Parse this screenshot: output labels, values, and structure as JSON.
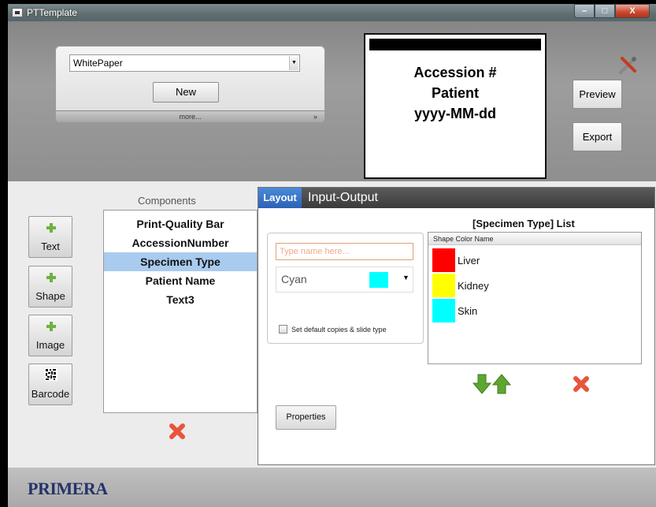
{
  "window": {
    "title": "PTTemplate",
    "controls": {
      "minimize": "–",
      "maximize": "□",
      "close": "X"
    }
  },
  "template": {
    "selected": "WhitePaper",
    "new_label": "New",
    "more_label": "more...",
    "more_chevron": "»"
  },
  "label_preview": {
    "lines": [
      "Accession #",
      "Patient",
      "yyyy-MM-dd"
    ]
  },
  "actions": {
    "preview_label": "Preview",
    "export_label": "Export",
    "tools_icon": "tools-icon"
  },
  "toolbox": {
    "items": [
      {
        "label": "Text",
        "icon": "plus-icon"
      },
      {
        "label": "Shape",
        "icon": "plus-icon"
      },
      {
        "label": "Image",
        "icon": "plus-icon"
      },
      {
        "label": "Barcode",
        "icon": "barcode-icon"
      }
    ]
  },
  "components": {
    "title": "Components",
    "items": [
      "Print-Quality Bar",
      "AccessionNumber",
      "Specimen Type",
      "Patient Name",
      "Text3"
    ],
    "selected_index": 2
  },
  "tabs": {
    "layout": "Layout",
    "input_output": "Input-Output",
    "active": "Layout"
  },
  "properties": {
    "name_placeholder": "Type name here...",
    "color_name": "Cyan",
    "color_hex": "#00ffff",
    "checkbox_label": "Set default copies & slide type",
    "properties_button": "Properties"
  },
  "specimen_list": {
    "title": "[Specimen Type] List",
    "header": "Shape Color Name",
    "items": [
      {
        "color": "#ff0000",
        "name": "Liver"
      },
      {
        "color": "#ffff00",
        "name": "Kidney"
      },
      {
        "color": "#00ffff",
        "name": "Skin"
      }
    ]
  },
  "footer": {
    "brand": "PRIMERA"
  }
}
